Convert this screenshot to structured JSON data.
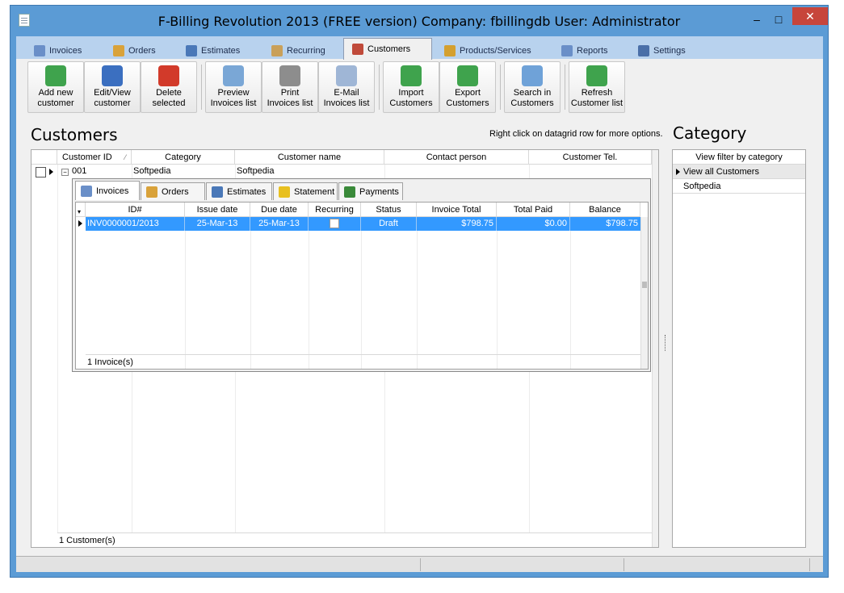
{
  "window": {
    "title": "F-Billing Revolution 2013 (FREE version) Company: fbillingdb User: Administrator",
    "min_glyph": "–",
    "max_glyph": "□",
    "close_glyph": "✕"
  },
  "tabs": [
    {
      "label": "Invoices",
      "icon": "invoice-icon",
      "color": "#6a8fc8"
    },
    {
      "label": "Orders",
      "icon": "orders-icon",
      "color": "#d9a23a"
    },
    {
      "label": "Estimates",
      "icon": "estimates-icon",
      "color": "#4a78b8"
    },
    {
      "label": "Recurring",
      "icon": "recurring-icon",
      "color": "#c9a05a"
    },
    {
      "label": "Customers",
      "icon": "customers-icon",
      "color": "#c04a3a"
    },
    {
      "label": "Products/Services",
      "icon": "products-icon",
      "color": "#d4a030"
    },
    {
      "label": "Reports",
      "icon": "reports-icon",
      "color": "#6a8fc8"
    },
    {
      "label": "Settings",
      "icon": "settings-icon",
      "color": "#4a6fa8"
    }
  ],
  "toolbar": {
    "buttons": [
      {
        "line1": "Add new",
        "line2": "customer",
        "icon": "add-customer-icon",
        "color": "#3fa34d"
      },
      {
        "line1": "Edit/View",
        "line2": "customer",
        "icon": "edit-customer-icon",
        "color": "#3b6fc0"
      },
      {
        "line1": "Delete",
        "line2": "selected",
        "icon": "delete-customer-icon",
        "color": "#d23a2a"
      },
      {
        "line1": "Preview",
        "line2": "Invoices list",
        "icon": "preview-icon",
        "color": "#7aa7d6"
      },
      {
        "line1": "Print",
        "line2": "Invoices list",
        "icon": "print-icon",
        "color": "#8d8d8d"
      },
      {
        "line1": "E-Mail",
        "line2": "Invoices list",
        "icon": "email-icon",
        "color": "#9fb6d6"
      },
      {
        "line1": "Import",
        "line2": "Customers",
        "icon": "import-icon",
        "color": "#3fa34d"
      },
      {
        "line1": "Export",
        "line2": "Customers",
        "icon": "export-icon",
        "color": "#3fa34d"
      },
      {
        "line1": "Search in",
        "line2": "Customers",
        "icon": "search-icon",
        "color": "#6fa2d8"
      },
      {
        "line1": "Refresh",
        "line2": "Customer list",
        "icon": "refresh-icon",
        "color": "#3fa34d"
      }
    ]
  },
  "customers": {
    "heading": "Customers",
    "hint": "Right click on datagrid row for more options.",
    "columns": [
      "Customer ID",
      "Category",
      "Customer name",
      "Contact person",
      "Customer Tel."
    ],
    "sort_glyph": "⁄",
    "row": {
      "id": "001",
      "category": "Softpedia",
      "name": "Softpedia"
    },
    "expand_glyph": "−",
    "footer": "1 Customer(s)"
  },
  "detail": {
    "tabs": [
      {
        "label": "Invoices",
        "icon": "invoice-icon",
        "color": "#6a8fc8"
      },
      {
        "label": "Orders",
        "icon": "orders-icon",
        "color": "#d9a23a"
      },
      {
        "label": "Estimates",
        "icon": "estimates-icon",
        "color": "#4a78b8"
      },
      {
        "label": "Statement",
        "icon": "warning-icon",
        "color": "#e8c020"
      },
      {
        "label": "Payments",
        "icon": "money-icon",
        "color": "#3a8a3a"
      }
    ],
    "columns": [
      "ID#",
      "Issue date",
      "Due date",
      "Recurring",
      "Status",
      "Invoice Total",
      "Total Paid",
      "Balance"
    ],
    "invoice": {
      "id": "INV0000001/2013",
      "issue_date": "25-Mar-13",
      "due_date": "25-Mar-13",
      "status": "Draft",
      "total": "$798.75",
      "paid": "$0.00",
      "balance": "$798.75"
    },
    "footer": "1 Invoice(s)"
  },
  "category": {
    "heading": "Category",
    "column": "View filter by category",
    "items": [
      "View all Customers",
      "Softpedia"
    ]
  },
  "colors": {
    "accent": "#5b9bd5",
    "selection": "#3399ff",
    "close": "#c7453b"
  }
}
